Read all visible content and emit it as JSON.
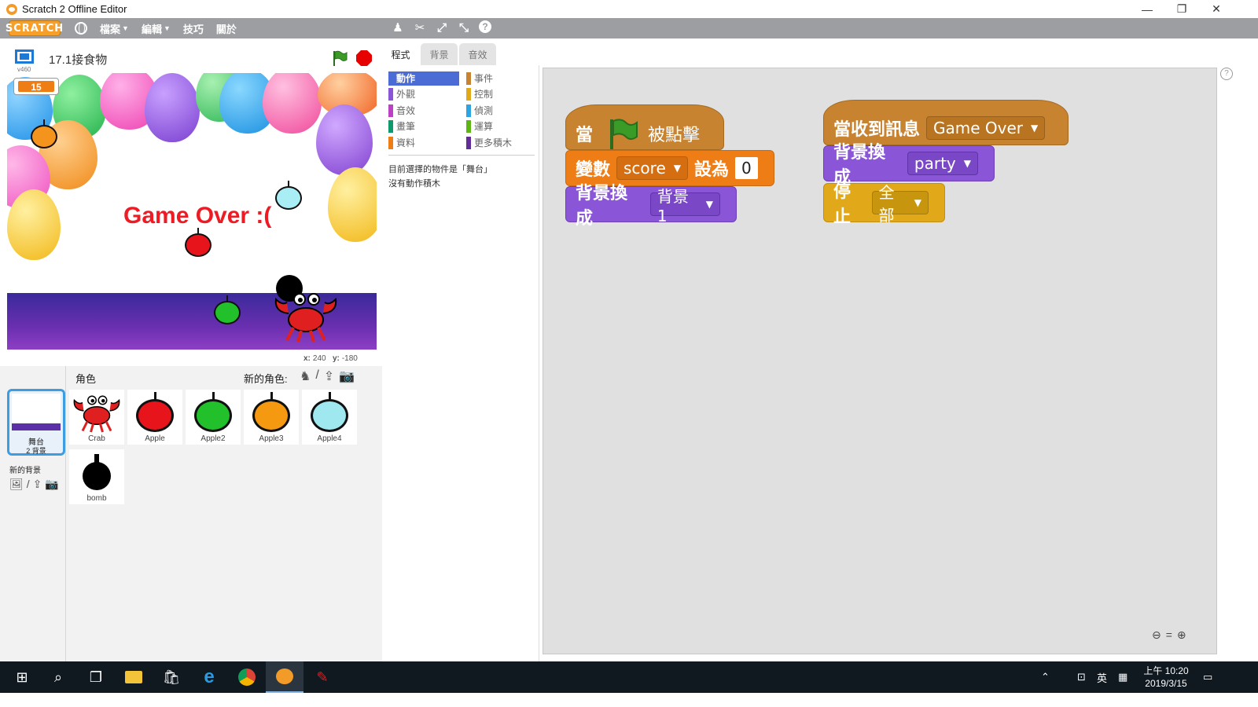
{
  "window": {
    "title": "Scratch 2 Offline Editor",
    "controls": [
      "—",
      "❐",
      "✕"
    ]
  },
  "menubar": {
    "logo": "SCRATCH",
    "items": [
      "檔案",
      "編輯",
      "技巧",
      "關於"
    ]
  },
  "stage": {
    "version": "v460",
    "project_title": "17.1接食物",
    "score_value": "15",
    "game_over_text": "Game Over :(",
    "coords": {
      "x_label": "x:",
      "x_value": "240",
      "y_label": "y:",
      "y_value": "-180"
    }
  },
  "sprites": {
    "label": "角色",
    "new_sprite_label": "新的角色:",
    "stage_thumb": {
      "name": "舞台",
      "backdrops": "2 背景"
    },
    "new_backdrop_label": "新的背景",
    "items": [
      {
        "name": "Crab",
        "color": "#e02020"
      },
      {
        "name": "Apple",
        "color": "#e8141c"
      },
      {
        "name": "Apple2",
        "color": "#22c02a"
      },
      {
        "name": "Apple3",
        "color": "#f59a10"
      },
      {
        "name": "Apple4",
        "color": "#9fe8f0"
      },
      {
        "name": "bomb",
        "color": "#000000"
      }
    ]
  },
  "tabs": [
    "程式",
    "背景",
    "音效"
  ],
  "categories": {
    "left": [
      {
        "label": "動作",
        "color": "#4a6cd4",
        "active": true
      },
      {
        "label": "外觀",
        "color": "#8a55d7"
      },
      {
        "label": "音效",
        "color": "#bb42c3"
      },
      {
        "label": "畫筆",
        "color": "#0e9a6c"
      },
      {
        "label": "資料",
        "color": "#ee7d16"
      }
    ],
    "right": [
      {
        "label": "事件",
        "color": "#c88330"
      },
      {
        "label": "控制",
        "color": "#e1a91a"
      },
      {
        "label": "偵測",
        "color": "#2ca5e2"
      },
      {
        "label": "運算",
        "color": "#5cb712"
      },
      {
        "label": "更多積木",
        "color": "#632d99"
      }
    ]
  },
  "palette_message": {
    "line1": "目前選擇的物件是「舞台」",
    "line2": "沒有動作積木"
  },
  "script1": {
    "hat_prefix": "當",
    "hat_suffix": "被點擊",
    "set_label": "變數",
    "set_var": "score",
    "set_to": "設為",
    "set_value": "0",
    "switch_label": "背景換成",
    "switch_value": "背景1"
  },
  "script2": {
    "hat_label": "當收到訊息",
    "hat_message": "Game Over",
    "switch_label": "背景換成",
    "switch_value": "party",
    "stop_label": "停止",
    "stop_value": "全部"
  },
  "taskbar": {
    "ime": "英",
    "clock_time": "上午 10:20",
    "clock_date": "2019/3/15"
  }
}
